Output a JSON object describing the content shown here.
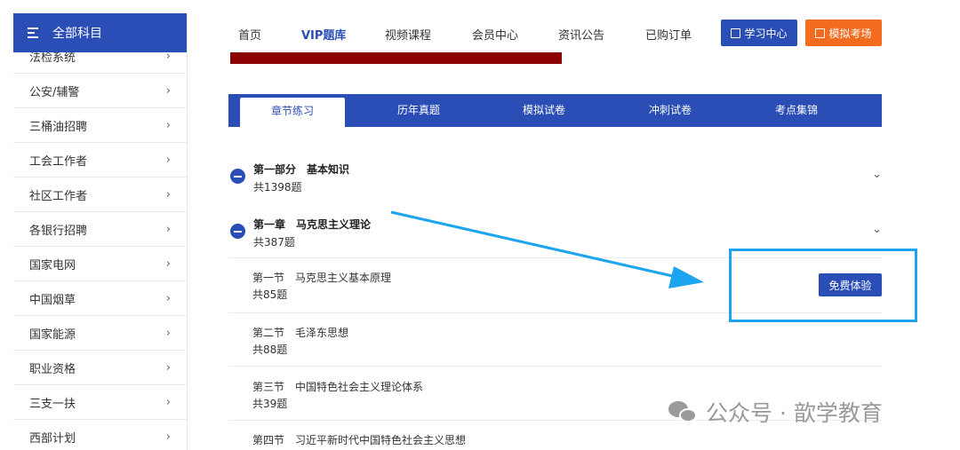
{
  "sidebar": {
    "header": "全部科目",
    "items": [
      {
        "label": "法检系统"
      },
      {
        "label": "公安/辅警"
      },
      {
        "label": "三桶油招聘"
      },
      {
        "label": "工会工作者"
      },
      {
        "label": "社区工作者"
      },
      {
        "label": "各银行招聘"
      },
      {
        "label": "国家电网"
      },
      {
        "label": "中国烟草"
      },
      {
        "label": "国家能源"
      },
      {
        "label": "职业资格"
      },
      {
        "label": "三支一扶"
      },
      {
        "label": "西部计划"
      }
    ]
  },
  "nav": {
    "links": [
      "首页",
      "VIP题库",
      "视频课程",
      "会员中心",
      "资讯公告",
      "已购订单"
    ],
    "study_center": "学习中心",
    "mock_exam": "模拟考场"
  },
  "tabs": [
    "章节练习",
    "历年真题",
    "模拟试卷",
    "冲刺试卷",
    "考点集锦"
  ],
  "parts": [
    {
      "title": "第一部分　基本知识",
      "count": "共1398题"
    },
    {
      "title": "第一章　马克思主义理论",
      "count": "共387题"
    }
  ],
  "sections": [
    {
      "title": "第一节　马克思主义基本原理",
      "count": "共85题"
    },
    {
      "title": "第二节　毛泽东思想",
      "count": "共88题"
    },
    {
      "title": "第三节　中国特色社会主义理论体系",
      "count": "共39题"
    },
    {
      "title": "第四节　习近平新时代中国特色社会主义思想",
      "count": ""
    }
  ],
  "free_trial": "免费体验",
  "watermark": "公众号 · 歆学教育",
  "colors": {
    "primary": "#2a4db6",
    "orange": "#f26b1f",
    "highlight": "#1da4ee",
    "banner": "#8b0000"
  }
}
